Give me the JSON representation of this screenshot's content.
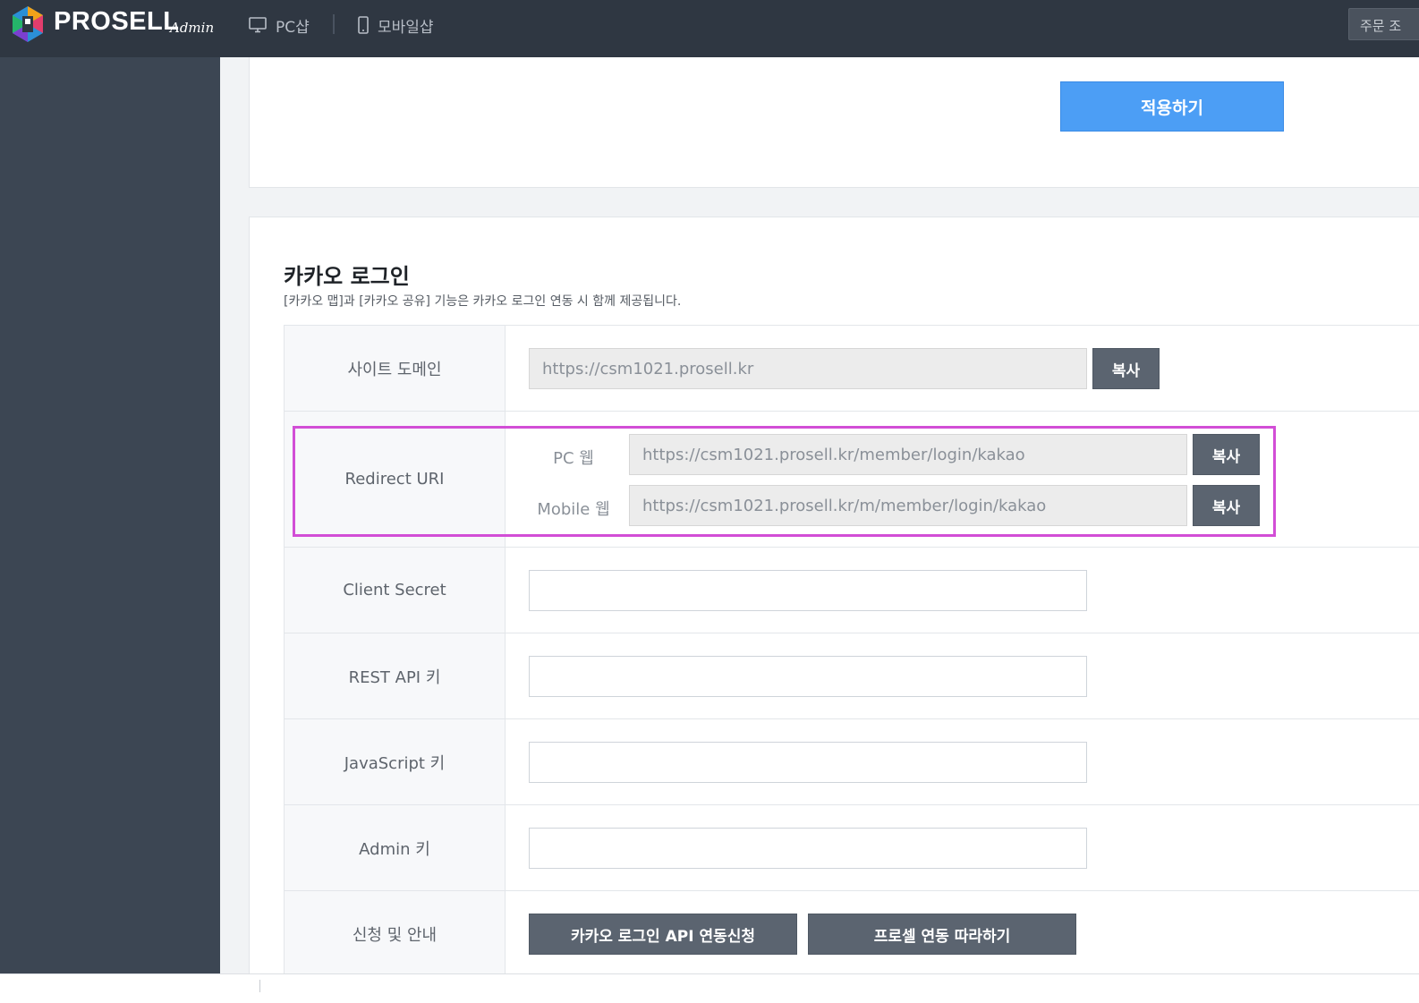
{
  "header": {
    "brand": "PROSELL",
    "brand_sub": "Admin",
    "nav": [
      {
        "label": "PC샵",
        "icon": "monitor-icon"
      },
      {
        "label": "모바일샵",
        "icon": "phone-icon"
      }
    ],
    "right_button": "주문 조"
  },
  "top_card": {
    "apply_label": "적용하기"
  },
  "kakao": {
    "title": "카카오 로그인",
    "description": "[카카오 맵]과 [카카오 공유] 기능은 카카오 로그인 연동 시 함께 제공됩니다.",
    "site_domain": {
      "label": "사이트 도메인",
      "value": "https://csm1021.prosell.kr",
      "copy_label": "복사"
    },
    "redirect_uri": {
      "label": "Redirect URI",
      "pc_label": "PC 웹",
      "pc_value": "https://csm1021.prosell.kr/member/login/kakao",
      "mobile_label": "Mobile 웹",
      "mobile_value": "https://csm1021.prosell.kr/m/member/login/kakao",
      "copy_label": "복사"
    },
    "client_secret": {
      "label": "Client Secret",
      "value": ""
    },
    "rest_api_key": {
      "label": "REST API 키",
      "value": ""
    },
    "javascript_key": {
      "label": "JavaScript 키",
      "value": ""
    },
    "admin_key": {
      "label": "Admin 키",
      "value": ""
    },
    "guide": {
      "label": "신청 및 안내",
      "apply_api_label": "카카오 로그인 API 연동신청",
      "follow_label": "프로셀 연동 따라하기"
    }
  },
  "colors": {
    "topbar": "#2f3742",
    "sidebar": "#3c4653",
    "primary_button": "#4c9ef5",
    "secondary_button": "#5b6470",
    "highlight": "#d24ed6"
  }
}
